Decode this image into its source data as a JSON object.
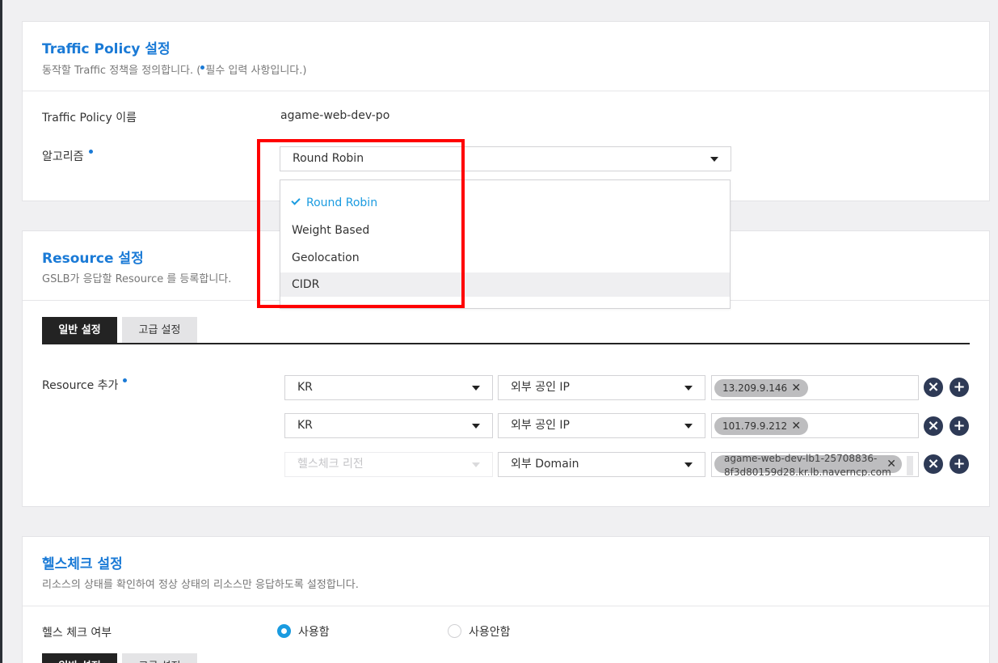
{
  "traffic_policy": {
    "title": "Traffic Policy 설정",
    "desc_before": "동작할 Traffic 정책을 정의합니다. (",
    "desc_after": "필수 입력 사항입니다.)",
    "name_label": "Traffic Policy 이름",
    "name_value": "agame-web-dev-po",
    "algorithm_label": "알고리즘",
    "algorithm_selected": "Round Robin",
    "algorithm_options": [
      "Round Robin",
      "Weight Based",
      "Geolocation",
      "CIDR"
    ]
  },
  "resource": {
    "title": "Resource 설정",
    "desc": "GSLB가 응답할 Resource 를 등록합니다.",
    "tabs": [
      "일반 설정",
      "고급 설정"
    ],
    "add_label": "Resource 추가",
    "rows": [
      {
        "region": "KR",
        "type": "외부 공인 IP",
        "tag": "13.209.9.146"
      },
      {
        "region": "KR",
        "type": "외부 공인 IP",
        "tag": "101.79.9.212"
      },
      {
        "region": "헬스체크 리전",
        "type": "외부 Domain",
        "tag": "agame-web-dev-lb1-25708836-8f3d80159d28.kr.lb.naverncp.com"
      }
    ],
    "remove_glyph": "×",
    "add_glyph": "+"
  },
  "healthcheck": {
    "title": "헬스체크 설정",
    "desc": "리소스의 상태를 확인하여 정상 상태의 리소스만 응답하도록 설정합니다.",
    "enable_label": "헬스 체크 여부",
    "option_on": "사용함",
    "option_off": "사용안함",
    "tabs": [
      "일반 설정",
      "고급 설정"
    ]
  },
  "colors": {
    "accent": "#1a7ad6",
    "highlight": "#ff0000",
    "dark_button": "#2e3a56"
  }
}
